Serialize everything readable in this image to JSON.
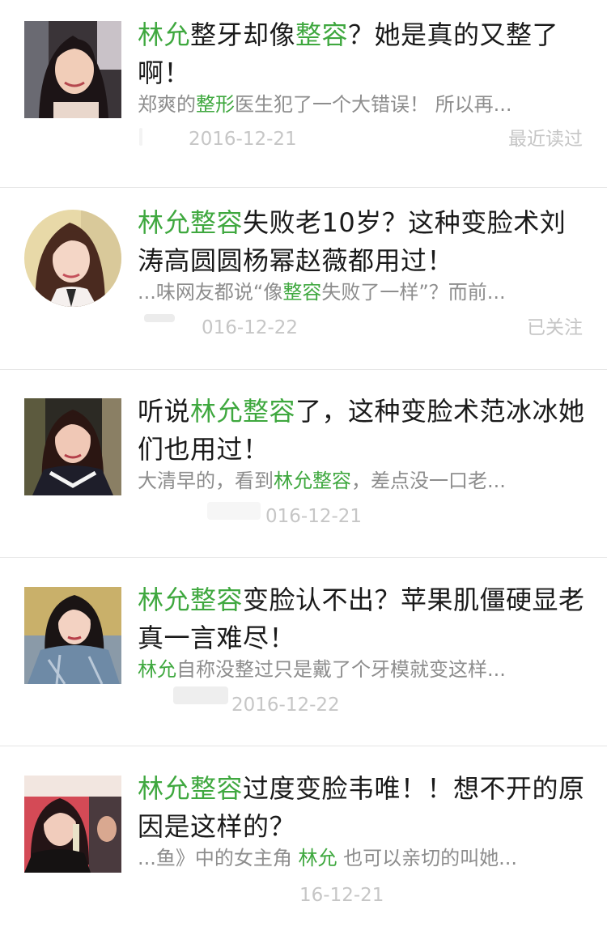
{
  "articles": [
    {
      "title_pre": "",
      "title_hl": "林允",
      "title_mid": "整牙却像",
      "title_hl2": "整容",
      "title_post": "？她是真的又整了啊！",
      "summary_pre": "郑爽的",
      "summary_hl": "整形",
      "summary_post": "医生犯了一个大错误！ 所以再...",
      "date": "2016-12-21",
      "status": "最近读过",
      "thumb": "portrait-smiling-woman"
    },
    {
      "title_pre": "",
      "title_hl": "林允整容",
      "title_mid": "失败老10岁？这种变脸术刘涛高圆圆杨幂赵薇都用过！",
      "title_hl2": "",
      "title_post": "",
      "summary_pre": "...味网友都说“像",
      "summary_hl": "整容",
      "summary_post": "失败了一样”？而前...",
      "date": "016-12-22",
      "status": "已关注",
      "thumb": "portrait-round-woman"
    },
    {
      "title_pre": "听说",
      "title_hl": "林允整容",
      "title_mid": "了，这种变脸术范冰冰她们也用过！",
      "title_hl2": "",
      "title_post": "",
      "summary_pre": "大清早的，看到",
      "summary_hl": "林允整容",
      "summary_post": "，差点没一口老...",
      "date": "016-12-21",
      "status": "",
      "thumb": "portrait-sailor-top"
    },
    {
      "title_pre": "",
      "title_hl": "林允整容",
      "title_mid": "变脸认不出？苹果肌僵硬显老真一言难尽！",
      "title_hl2": "",
      "title_post": "",
      "summary_pre": "",
      "summary_hl": "林允",
      "summary_post": "自称没整过只是戴了个牙模就变这样...",
      "date": "2016-12-22",
      "status": "",
      "thumb": "portrait-denim-jacket"
    },
    {
      "title_pre": "",
      "title_hl": "林允整容",
      "title_mid": "过度变脸韦唯！！想不开的原因是这样的？",
      "title_hl2": "",
      "title_post": "",
      "summary_pre": "...鱼》中的女主角 ",
      "summary_hl": "林允",
      "summary_post": " 也可以亲切的叫她...",
      "date": "16-12-21",
      "status": "",
      "thumb": "portrait-drinking-event"
    }
  ],
  "colors": {
    "highlight": "#3fa83f",
    "title": "#1a1a1a",
    "summary": "#8d8d8d",
    "meta": "#c6c6c6",
    "divider": "#e5e5e5"
  }
}
